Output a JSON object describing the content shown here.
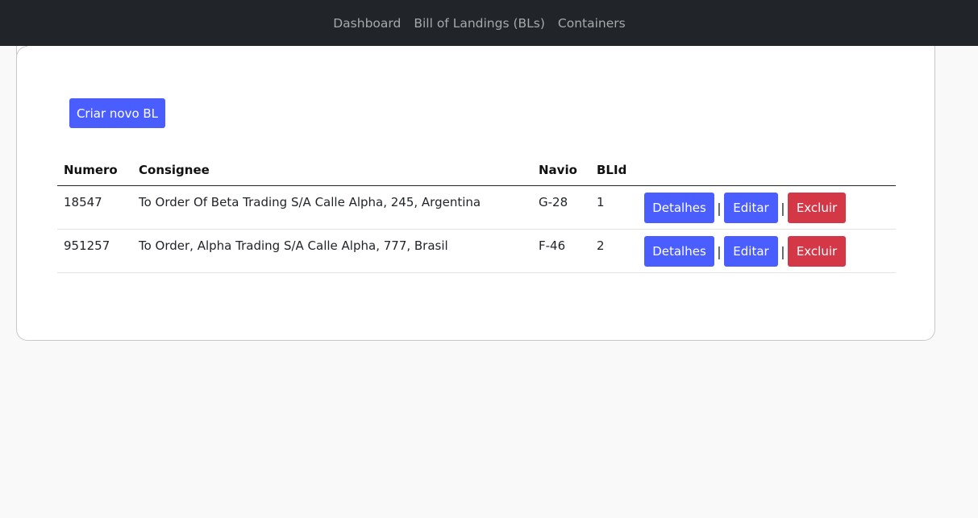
{
  "nav": {
    "links": [
      {
        "label": "Dashboard"
      },
      {
        "label": "Bill of Landings (BLs)"
      },
      {
        "label": "Containers"
      }
    ]
  },
  "main": {
    "create_label": "Criar novo BL",
    "table": {
      "headers": [
        "Numero",
        "Consignee",
        "Navio",
        "BLId",
        ""
      ],
      "rows": [
        {
          "numero": "18547",
          "consignee": "To Order Of Beta Trading S/A Calle Alpha, 245, Argentina",
          "navio": "G-28",
          "blid": "1"
        },
        {
          "numero": "951257",
          "consignee": "To Order, Alpha Trading S/A Calle Alpha, 777, Brasil",
          "navio": "F-46",
          "blid": "2"
        }
      ],
      "actions": {
        "details_label": "Detalhes",
        "edit_label": "Editar",
        "delete_label": "Excluir",
        "separator": "|"
      }
    }
  },
  "colors": {
    "navbar": "#212529",
    "primary": "#4a5eff",
    "danger": "#d43745",
    "page_bg": "#f9f9f9"
  }
}
